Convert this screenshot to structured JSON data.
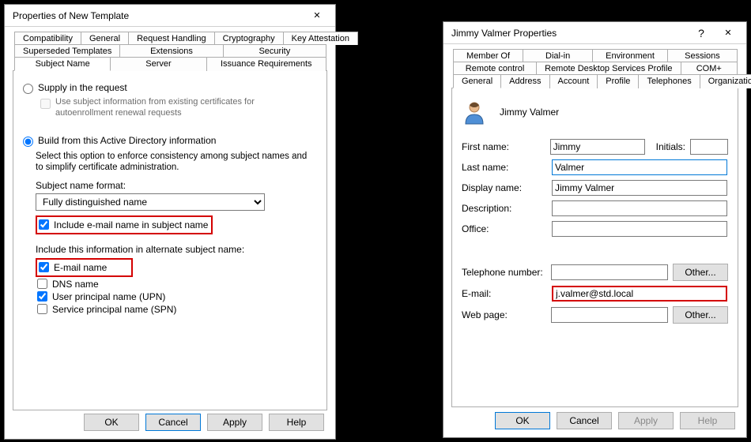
{
  "template_dlg": {
    "title": "Properties of New Template",
    "tabs_row1": [
      "Compatibility",
      "General",
      "Request Handling",
      "Cryptography",
      "Key Attestation"
    ],
    "tabs_row2": [
      "Superseded Templates",
      "Extensions",
      "Security"
    ],
    "tabs_row3": [
      "Subject Name",
      "Server",
      "Issuance Requirements"
    ],
    "active_tab": "Subject Name",
    "opt_supply": "Supply in the request",
    "opt_supply_help": "Use subject information from existing certificates for autoenrollment renewal requests",
    "opt_build": "Build from this Active Directory information",
    "opt_build_help": "Select this option to enforce consistency among subject names and to simplify certificate administration.",
    "snf_label": "Subject name format:",
    "snf_value": "Fully distinguished name",
    "chk_email_in_sn": "Include e-mail name in subject name",
    "alt_label": "Include this information in alternate subject name:",
    "chk_email": "E-mail name",
    "chk_dns": "DNS name",
    "chk_upn": "User principal name (UPN)",
    "chk_spn": "Service principal name (SPN)",
    "btn_ok": "OK",
    "btn_cancel": "Cancel",
    "btn_apply": "Apply",
    "btn_help": "Help"
  },
  "user_dlg": {
    "title": "Jimmy Valmer Properties",
    "tabs_row1": [
      "Member Of",
      "Dial-in",
      "Environment",
      "Sessions"
    ],
    "tabs_row2": [
      "Remote control",
      "Remote Desktop Services Profile",
      "COM+"
    ],
    "tabs_row3": [
      "General",
      "Address",
      "Account",
      "Profile",
      "Telephones",
      "Organization"
    ],
    "active_tab": "General",
    "display_name_header": "Jimmy Valmer",
    "first_name_lbl": "First name:",
    "first_name": "Jimmy",
    "initials_lbl": "Initials:",
    "initials": "",
    "last_name_lbl": "Last name:",
    "last_name": "Valmer",
    "display_name_lbl": "Display name:",
    "display_name": "Jimmy Valmer",
    "description_lbl": "Description:",
    "description": "",
    "office_lbl": "Office:",
    "office": "",
    "tel_lbl": "Telephone number:",
    "tel": "",
    "email_lbl": "E-mail:",
    "email": "j.valmer@std.local",
    "web_lbl": "Web page:",
    "web": "",
    "btn_other": "Other...",
    "btn_ok": "OK",
    "btn_cancel": "Cancel",
    "btn_apply": "Apply",
    "btn_help": "Help"
  }
}
